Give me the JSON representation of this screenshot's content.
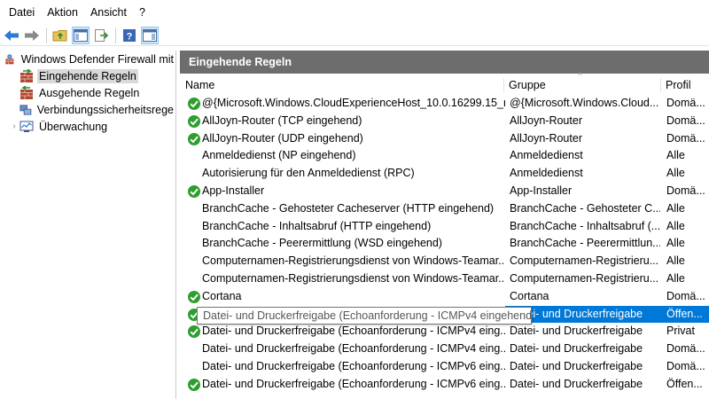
{
  "menubar": {
    "items": [
      "Datei",
      "Aktion",
      "Ansicht",
      "?"
    ]
  },
  "toolbar": {
    "buttons": [
      "back-arrow-icon",
      "forward-arrow-icon",
      "folder-up-icon",
      "console-tree-icon",
      "export-list-icon",
      "help-icon",
      "action-pane-icon"
    ]
  },
  "tree": {
    "items": [
      {
        "label": "Windows Defender Firewall mit",
        "icon": "firewall-icon"
      },
      {
        "label": "Eingehende Regeln",
        "icon": "inbound-rules-icon"
      },
      {
        "label": "Ausgehende Regeln",
        "icon": "outbound-rules-icon"
      },
      {
        "label": "Verbindungssicherheitsrege",
        "icon": "connection-security-icon"
      },
      {
        "label": "Überwachung",
        "icon": "monitoring-icon"
      }
    ]
  },
  "main": {
    "header": "Eingehende Regeln",
    "columns": {
      "name": "Name",
      "group": "Gruppe",
      "profile": "Profil"
    },
    "sort_indicator": "^",
    "rows": [
      {
        "name": "@{Microsoft.Windows.CloudExperienceHost_10.0.16299.15_ne...",
        "group": "@{Microsoft.Windows.Cloud...",
        "profile": "Domä...",
        "enabled": true
      },
      {
        "name": "AllJoyn-Router (TCP eingehend)",
        "group": "AllJoyn-Router",
        "profile": "Domä...",
        "enabled": true
      },
      {
        "name": "AllJoyn-Router (UDP eingehend)",
        "group": "AllJoyn-Router",
        "profile": "Domä...",
        "enabled": true
      },
      {
        "name": "Anmeldedienst (NP eingehend)",
        "group": "Anmeldedienst",
        "profile": "Alle",
        "enabled": false
      },
      {
        "name": "Autorisierung für den Anmeldedienst (RPC)",
        "group": "Anmeldedienst",
        "profile": "Alle",
        "enabled": false
      },
      {
        "name": "App-Installer",
        "group": "App-Installer",
        "profile": "Domä...",
        "enabled": true
      },
      {
        "name": "BranchCache - Gehosteter Cacheserver (HTTP eingehend)",
        "group": "BranchCache - Gehosteter C...",
        "profile": "Alle",
        "enabled": false
      },
      {
        "name": "BranchCache - Inhaltsabruf (HTTP eingehend)",
        "group": "BranchCache - Inhaltsabruf (...",
        "profile": "Alle",
        "enabled": false
      },
      {
        "name": "BranchCache - Peerermittlung (WSD eingehend)",
        "group": "BranchCache - Peerermittlun...",
        "profile": "Alle",
        "enabled": false
      },
      {
        "name": "Computernamen-Registrierungsdienst von Windows-Teamar...",
        "group": "Computernamen-Registrieru...",
        "profile": "Alle",
        "enabled": false
      },
      {
        "name": "Computernamen-Registrierungsdienst von Windows-Teamar...",
        "group": "Computernamen-Registrieru...",
        "profile": "Alle",
        "enabled": false
      },
      {
        "name": "Cortana",
        "group": "Cortana",
        "profile": "Domä...",
        "enabled": true
      },
      {
        "name": "Datei- und Druckerfreigabe (Echoanforderung - ICMPv4 eing...",
        "group": "Datei- und Druckerfreigabe",
        "profile": "Öffen...",
        "enabled": true,
        "selected": true
      },
      {
        "name": "Datei- und Druckerfreigabe (Echoanforderung - ICMPv4 eing...",
        "group": "Datei- und Druckerfreigabe",
        "profile": "Privat",
        "enabled": true
      },
      {
        "name": "Datei- und Druckerfreigabe (Echoanforderung - ICMPv4 eing...",
        "group": "Datei- und Druckerfreigabe",
        "profile": "Domä...",
        "enabled": false
      },
      {
        "name": "Datei- und Druckerfreigabe (Echoanforderung - ICMPv6 eing...",
        "group": "Datei- und Druckerfreigabe",
        "profile": "Domä...",
        "enabled": false
      },
      {
        "name": "Datei- und Druckerfreigabe (Echoanforderung - ICMPv6 eing...",
        "group": "Datei- und Druckerfreigabe",
        "profile": "Öffen...",
        "enabled": true
      }
    ]
  },
  "tooltip": {
    "text": "Datei- und Druckerfreigabe (Echoanforderung - ICMPv4 eingehend)"
  },
  "colors": {
    "selection": "#0078d7",
    "header_bg": "#6d6d6d",
    "enabled_icon": "#2e9e2e"
  }
}
